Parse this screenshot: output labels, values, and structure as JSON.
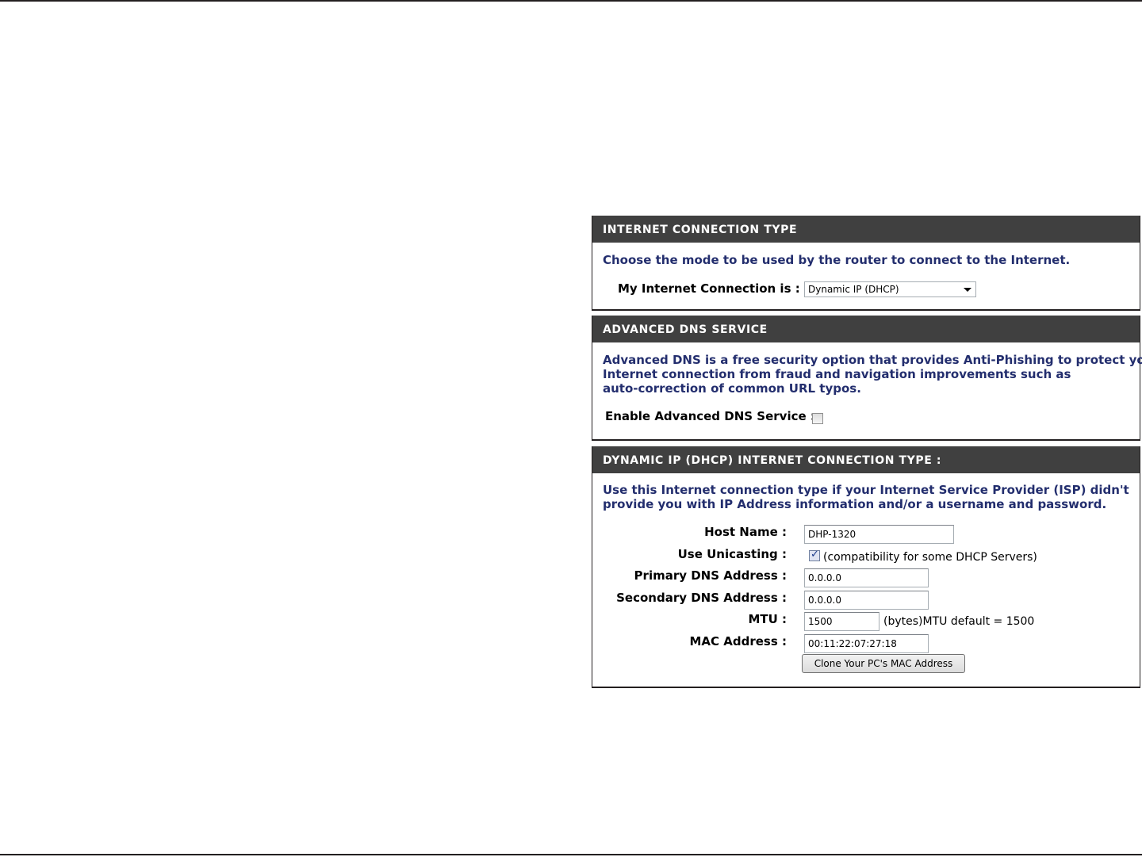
{
  "internet_connection_type": {
    "header": "INTERNET CONNECTION TYPE",
    "description": "Choose the mode to be used by the router to connect to the Internet.",
    "connection_label": "My Internet Connection is :",
    "connection_value": "Dynamic IP (DHCP)"
  },
  "advanced_dns": {
    "header": "ADVANCED DNS SERVICE",
    "description_lines": [
      "Advanced DNS is a free security option that provides Anti-Phishing to protect your",
      "Internet connection from fraud and navigation improvements such as",
      "auto-correction of common URL typos."
    ],
    "enable_label": "Enable Advanced DNS Service :",
    "enabled": false
  },
  "dhcp": {
    "header": "DYNAMIC IP (DHCP) INTERNET CONNECTION TYPE :",
    "description_lines": [
      "Use this Internet connection type if your Internet Service Provider (ISP) didn't",
      "provide you with IP Address information and/or a username and password."
    ],
    "host_name_label": "Host Name :",
    "host_name_value": "DHP-1320",
    "unicasting_label": "Use Unicasting :",
    "unicasting_checked": true,
    "unicasting_note": "(compatibility for some DHCP Servers)",
    "primary_dns_label": "Primary DNS Address :",
    "primary_dns_value": "0.0.0.0",
    "secondary_dns_label": "Secondary DNS Address :",
    "secondary_dns_value": "0.0.0.0",
    "mtu_label": "MTU :",
    "mtu_value": "1500",
    "mtu_note": "(bytes)MTU default = 1500",
    "mac_label": "MAC Address :",
    "mac_value": "00:11:22:07:27:18",
    "clone_button": "Clone Your PC's MAC Address"
  }
}
